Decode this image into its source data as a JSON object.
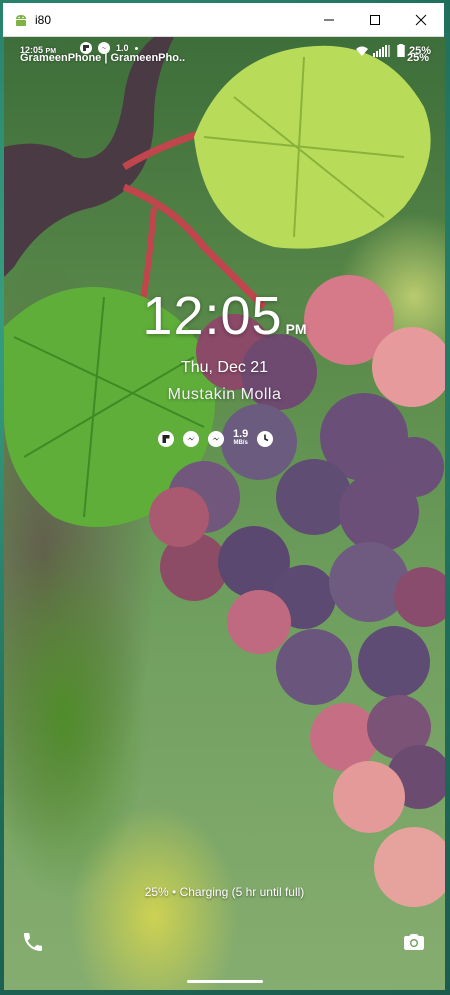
{
  "window": {
    "title": "i80",
    "icon": "android-icon"
  },
  "status_bar": {
    "time": "12:05",
    "ampm": "PM",
    "carrier": "GrameenPhone | GrameenPho..",
    "data_rate": "1.0",
    "battery_percent": "25%",
    "icons": [
      "flipboard-icon",
      "messenger-icon",
      "dot-icon",
      "wifi-icon",
      "signal-icon",
      "battery-charging-icon"
    ]
  },
  "lock_screen": {
    "time": "12:05",
    "ampm": "PM",
    "date": "Thu, Dec 21",
    "owner": "Mustakin Molla",
    "net_speed": {
      "value": "1.9",
      "unit": "MB/s"
    },
    "notification_icons": [
      "flipboard-icon",
      "messenger-icon",
      "messenger-icon",
      "net-speed",
      "clock-icon"
    ],
    "charging_text": "25% • Charging (5 hr until full)"
  },
  "colors": {
    "screen_bg": "#5d8d4c",
    "frame": "#2f8a74"
  }
}
